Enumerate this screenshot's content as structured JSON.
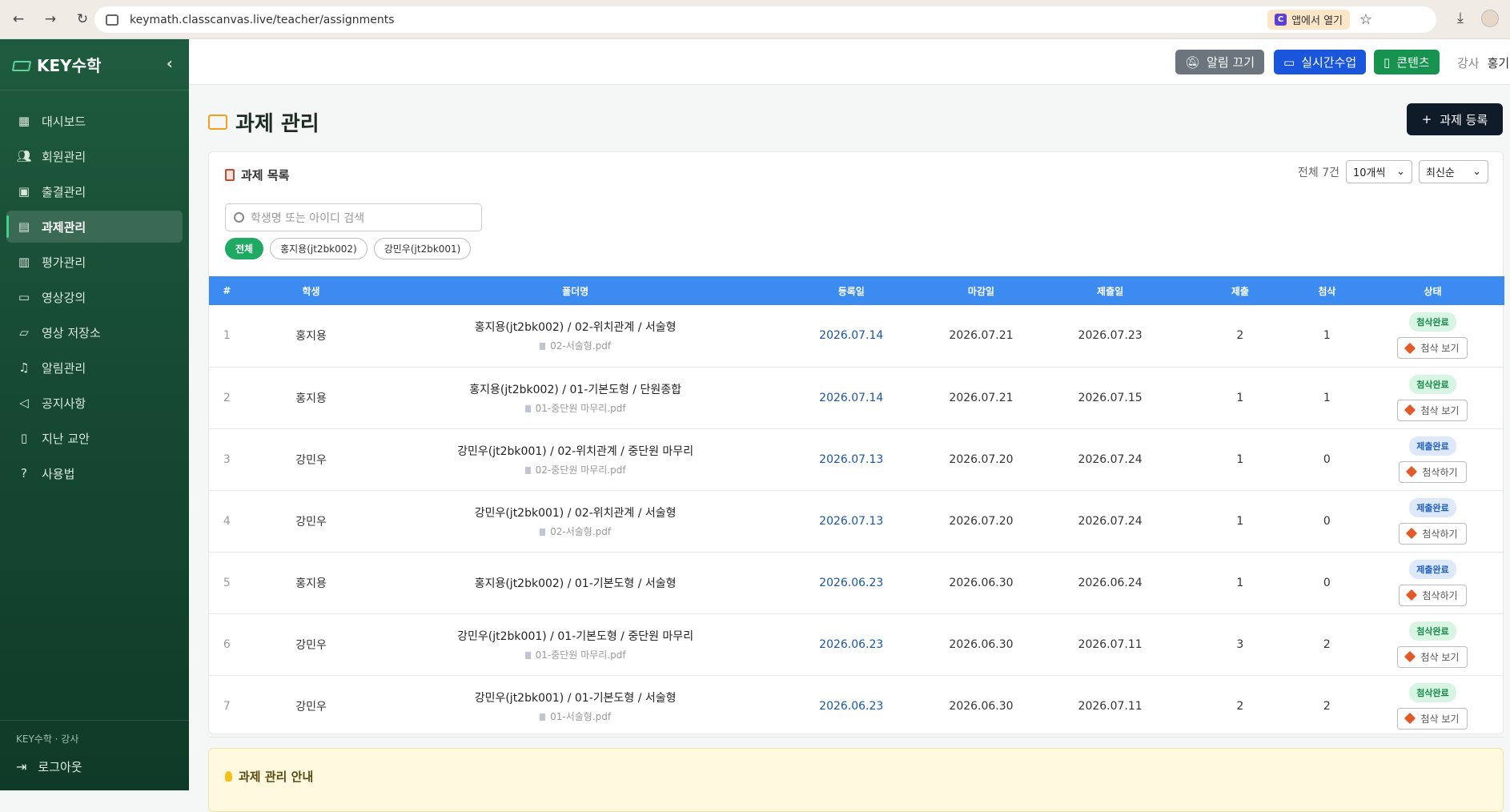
{
  "browser": {
    "url": "keymath.classcanvas.live/teacher/assignments",
    "open_in_app": "앱에서 열기"
  },
  "sidebar": {
    "brand": "KEY수학",
    "items": [
      {
        "label": "대시보드",
        "icon": "dashboard-icon"
      },
      {
        "label": "회원관리",
        "icon": "users-icon"
      },
      {
        "label": "출결관리",
        "icon": "calendar-check-icon"
      },
      {
        "label": "과제관리",
        "icon": "document-icon",
        "active": true
      },
      {
        "label": "평가관리",
        "icon": "clipboard-icon"
      },
      {
        "label": "영상강의",
        "icon": "video-icon"
      },
      {
        "label": "영상 저장소",
        "icon": "folder-icon"
      },
      {
        "label": "알림관리",
        "icon": "bell-icon"
      },
      {
        "label": "공지사항",
        "icon": "megaphone-icon"
      },
      {
        "label": "지난 교안",
        "icon": "book-icon"
      },
      {
        "label": "사용법",
        "icon": "help-icon"
      }
    ],
    "footer_user": "KEY수학 · 강사",
    "logout": "로그아웃"
  },
  "header": {
    "mute_label": "알림 끄기",
    "live_label": "실시간수업",
    "content_label": "콘텐츠",
    "role": "강사",
    "user": "홍기"
  },
  "page": {
    "title": "과제 관리",
    "add_label": "과제 등록"
  },
  "list": {
    "title": "과제 목록",
    "total": "전체 7건",
    "per_page": "10개씩",
    "sort": "최신순",
    "search_placeholder": "학생명 또는 아이디 검색",
    "filters": [
      "전체",
      "홍지용(jt2bk002)",
      "강민우(jt2bk001)"
    ],
    "columns": [
      "#",
      "학생",
      "폴더명",
      "등록일",
      "마감일",
      "제출일",
      "제출",
      "첨삭",
      "상태"
    ],
    "rows": [
      {
        "no": "1",
        "student": "홍지용",
        "folder": "홍지용(jt2bk002) / 02-위치관계 / 서술형",
        "file": "02-서술형.pdf",
        "reg": "2026.07.14",
        "due": "2026.07.21",
        "sub": "2026.07.23",
        "subs": "2",
        "corr": "1",
        "status": "첨삭완료",
        "action": "첨삭 보기"
      },
      {
        "no": "2",
        "student": "홍지용",
        "folder": "홍지용(jt2bk002) / 01-기본도형 / 단원종합",
        "file": "01-중단원 마무리.pdf",
        "reg": "2026.07.14",
        "due": "2026.07.21",
        "sub": "2026.07.15",
        "subs": "1",
        "corr": "1",
        "status": "첨삭완료",
        "action": "첨삭 보기"
      },
      {
        "no": "3",
        "student": "강민우",
        "folder": "강민우(jt2bk001) / 02-위치관계 / 중단원 마무리",
        "file": "02-중단원 마무리.pdf",
        "reg": "2026.07.13",
        "due": "2026.07.20",
        "sub": "2026.07.24",
        "subs": "1",
        "corr": "0",
        "status": "제출완료",
        "action": "첨삭하기"
      },
      {
        "no": "4",
        "student": "강민우",
        "folder": "강민우(jt2bk001) / 02-위치관계 / 서술형",
        "file": "02-서술형.pdf",
        "reg": "2026.07.13",
        "due": "2026.07.20",
        "sub": "2026.07.24",
        "subs": "1",
        "corr": "0",
        "status": "제출완료",
        "action": "첨삭하기"
      },
      {
        "no": "5",
        "student": "홍지용",
        "folder": "홍지용(jt2bk002) / 01-기본도형 / 서술형",
        "file": "",
        "reg": "2026.06.23",
        "due": "2026.06.30",
        "sub": "2026.06.24",
        "subs": "1",
        "corr": "0",
        "status": "제출완료",
        "action": "첨삭하기"
      },
      {
        "no": "6",
        "student": "강민우",
        "folder": "강민우(jt2bk001) / 01-기본도형 / 중단원 마무리",
        "file": "01-중단원 마무리.pdf",
        "reg": "2026.06.23",
        "due": "2026.06.30",
        "sub": "2026.07.11",
        "subs": "3",
        "corr": "2",
        "status": "첨삭완료",
        "action": "첨삭 보기"
      },
      {
        "no": "7",
        "student": "강민우",
        "folder": "강민우(jt2bk001) / 01-기본도형 / 서술형",
        "file": "01-서술형.pdf",
        "reg": "2026.06.23",
        "due": "2026.06.30",
        "sub": "2026.07.11",
        "subs": "2",
        "corr": "2",
        "status": "첨삭완료",
        "action": "첨삭 보기"
      }
    ]
  },
  "notice": {
    "title": "과제 관리 안내"
  },
  "colors": {
    "sidebar": "#1e5b3e",
    "table_header": "#3b8bf1",
    "done_badge": "#d8f5e4",
    "submitted_badge": "#dde8fb"
  }
}
